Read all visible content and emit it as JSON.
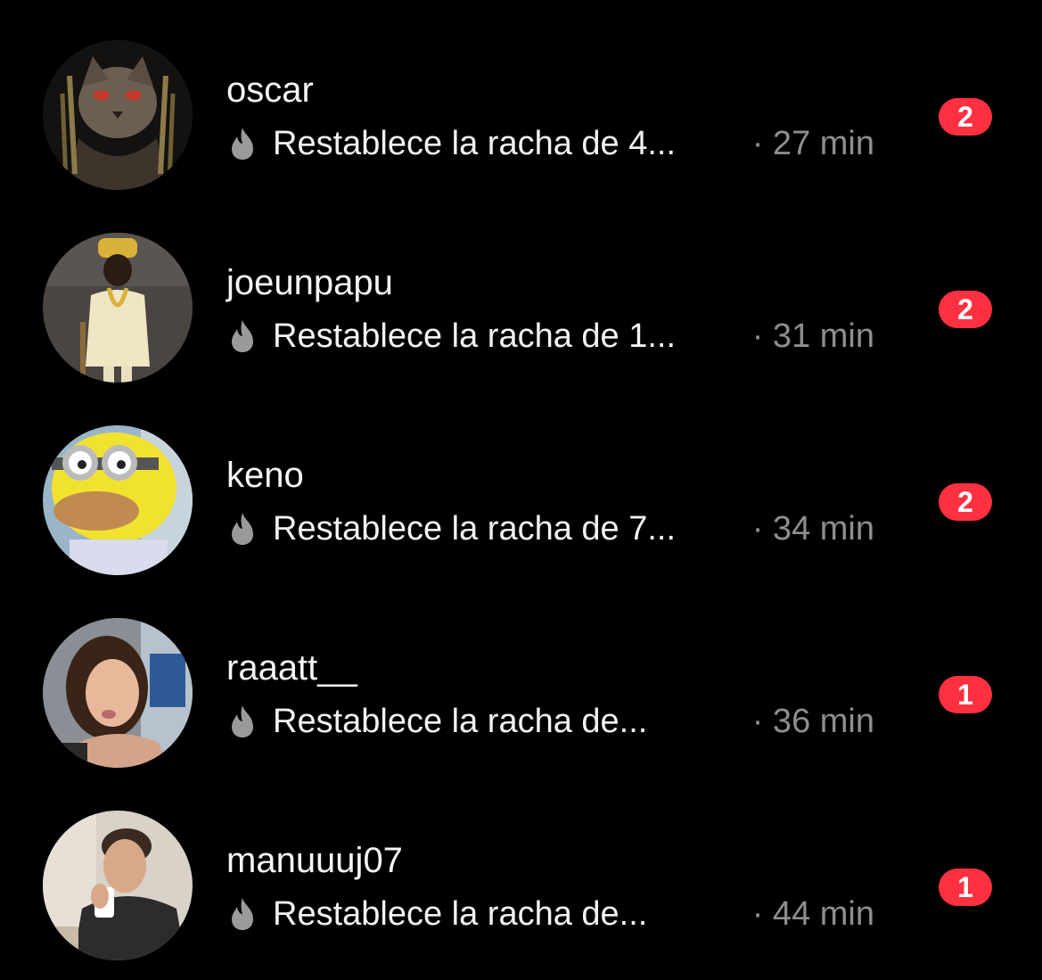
{
  "theme": {
    "background": "#000000",
    "badge_color": "#ff3040",
    "muted_text": "#8e8e8e"
  },
  "chats": [
    {
      "username": "oscar",
      "icon": "flame-icon",
      "preview": "Restablece la racha de 4...",
      "time": "· 27 min",
      "unread": "2"
    },
    {
      "username": "joeunpapu",
      "icon": "flame-icon",
      "preview": "Restablece la racha de 1...",
      "time": "· 31 min",
      "unread": "2"
    },
    {
      "username": "keno",
      "icon": "flame-icon",
      "preview": "Restablece la racha de 7...",
      "time": "· 34 min",
      "unread": "2"
    },
    {
      "username": "raaatt__",
      "icon": "flame-icon",
      "preview": "Restablece la racha de...",
      "time": "· 36 min",
      "unread": "1"
    },
    {
      "username": "manuuuj07",
      "icon": "flame-icon",
      "preview": "Restablece la racha de...",
      "time": "· 44 min",
      "unread": "1"
    }
  ]
}
